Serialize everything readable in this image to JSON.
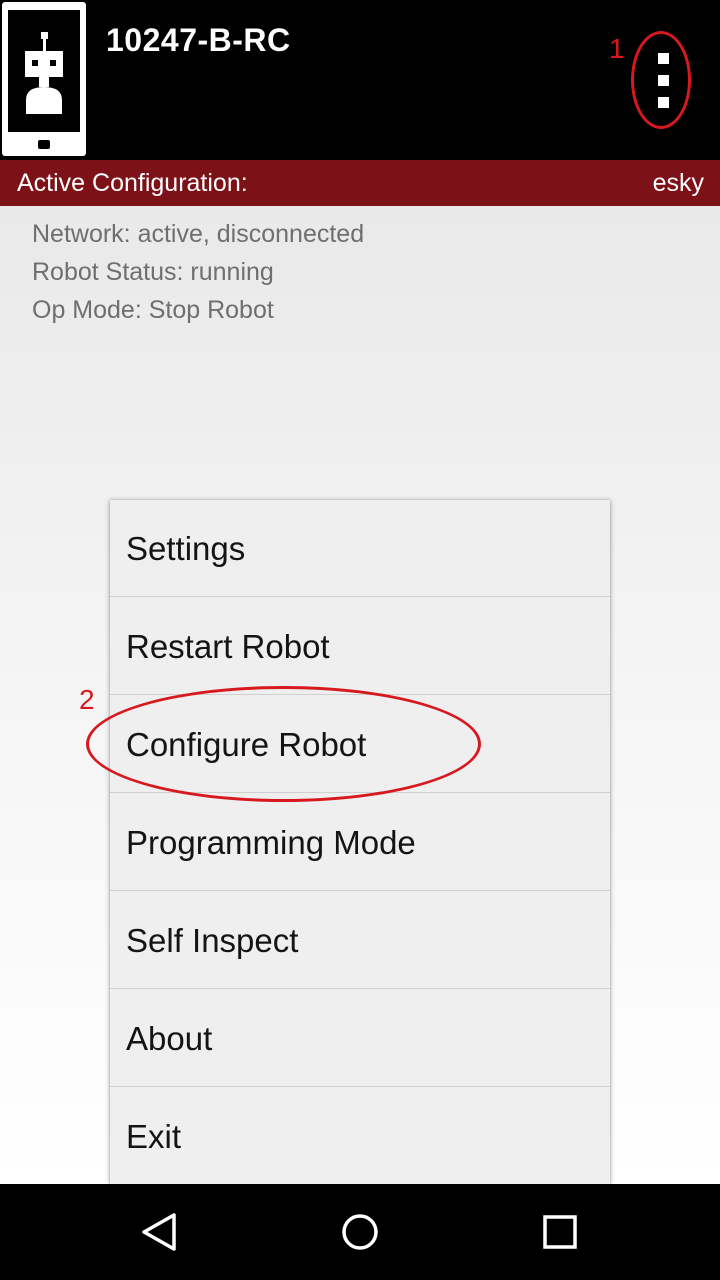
{
  "app_bar": {
    "title": "10247-B-RC",
    "app_icon": "robot-phone-icon",
    "overflow_icon": "more-vert-icon"
  },
  "config_bar": {
    "label": "Active Configuration:",
    "value": "esky"
  },
  "status": {
    "network": "Network: active, disconnected",
    "robot_status": "Robot Status: running",
    "op_mode": "Op Mode: Stop Robot"
  },
  "menu": {
    "items": [
      {
        "label": "Settings"
      },
      {
        "label": "Restart Robot"
      },
      {
        "label": "Configure Robot"
      },
      {
        "label": "Programming Mode"
      },
      {
        "label": "Self Inspect"
      },
      {
        "label": "About"
      },
      {
        "label": "Exit"
      }
    ]
  },
  "annotations": {
    "step1": "1",
    "step2": "2"
  },
  "nav_bar": {
    "back_icon": "back-triangle-icon",
    "home_icon": "home-circle-icon",
    "recents_icon": "recents-square-icon"
  },
  "colors": {
    "config_bar": "#7d1118",
    "annotation": "#d7191f",
    "menu_bg": "#efefef"
  }
}
